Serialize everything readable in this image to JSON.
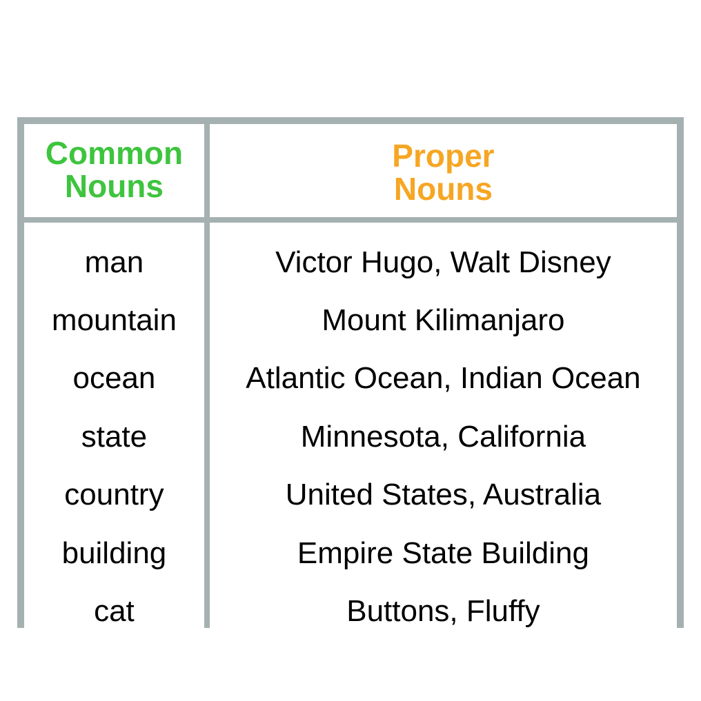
{
  "table": {
    "headers": {
      "common": "Common Nouns",
      "proper": "Proper Nouns"
    },
    "rows": [
      {
        "common": "man",
        "proper": "Victor Hugo,  Walt Disney"
      },
      {
        "common": "mountain",
        "proper": "Mount Kilimanjaro"
      },
      {
        "common": "ocean",
        "proper": "Atlantic Ocean, Indian Ocean"
      },
      {
        "common": "state",
        "proper": "Minnesota, California"
      },
      {
        "common": "country",
        "proper": "United States,  Australia"
      },
      {
        "common": "building",
        "proper": "Empire State Building"
      },
      {
        "common": "cat",
        "proper": "Buttons,  Fluffy"
      }
    ]
  }
}
